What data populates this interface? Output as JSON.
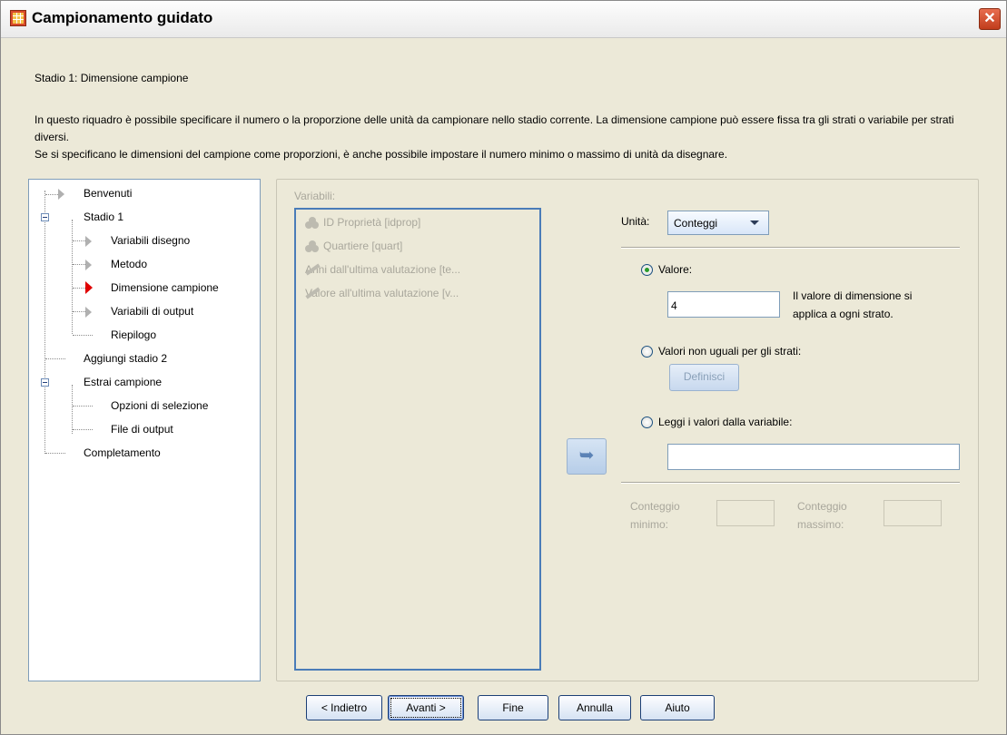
{
  "window": {
    "title": "Campionamento guidato",
    "close_icon": "close-icon"
  },
  "stage_title": "Stadio 1: Dimensione campione",
  "description": [
    "In questo riquadro è possibile specificare il numero o la proporzione delle unità da campionare nello stadio corrente. La dimensione campione può essere fissa tra gli strati o variabile per strati diversi.",
    "Se si specificano le dimensioni del campione come proporzioni, è anche possibile impostare il numero minimo o massimo di unità da disegnare."
  ],
  "nav": {
    "items": [
      {
        "label": "Benvenuti"
      },
      {
        "label": "Stadio 1"
      },
      {
        "label": "Variabili disegno"
      },
      {
        "label": "Metodo"
      },
      {
        "label": "Dimensione campione"
      },
      {
        "label": "Variabili di output"
      },
      {
        "label": "Riepilogo"
      },
      {
        "label": "Aggiungi stadio 2"
      },
      {
        "label": "Estrai campione"
      },
      {
        "label": "Opzioni di selezione"
      },
      {
        "label": "File di output"
      },
      {
        "label": "Completamento"
      }
    ],
    "active": "Dimensione campione",
    "active_color": "#e00000"
  },
  "variables": {
    "label": "Variabili:",
    "items": [
      {
        "label": "ID Proprietà [idprop]",
        "icon": "nominal-icon"
      },
      {
        "label": "Quartiere [quart]",
        "icon": "nominal-icon"
      },
      {
        "label": "Anni dall'ultima valutazione [te...",
        "icon": "scale-icon"
      },
      {
        "label": "Valore all'ultima valutazione [v...",
        "icon": "scale-icon"
      }
    ]
  },
  "move_button_icon": "arrow-right-icon",
  "units": {
    "label": "Unità:",
    "selected": "Conteggi"
  },
  "options": {
    "value_label": "Valore:",
    "value": "4",
    "value_note_line1": "Il valore di dimensione si",
    "value_note_line2": "applica a ogni strato.",
    "unequal_label": "Valori non uguali per gli strati:",
    "define_button": "Definisci",
    "read_label": "Leggi i valori dalla variabile:",
    "read_value": "",
    "selected": "value"
  },
  "counts": {
    "min_line1": "Conteggio",
    "min_line2": "minimo:",
    "max_line1": "Conteggio",
    "max_line2": "massimo:"
  },
  "buttons": {
    "back": "< Indietro",
    "next": "Avanti >",
    "finish": "Fine",
    "cancel": "Annulla",
    "help": "Aiuto"
  }
}
